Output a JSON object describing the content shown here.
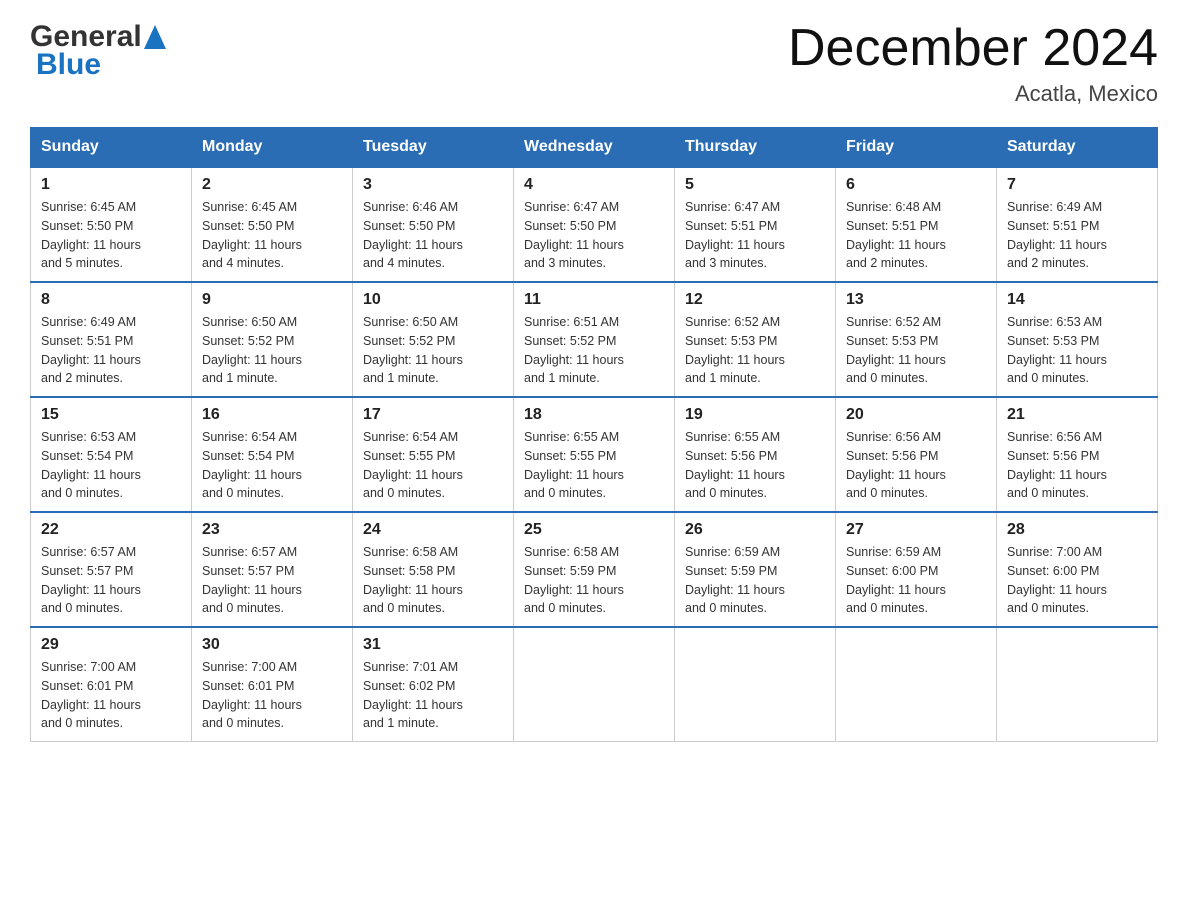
{
  "header": {
    "title": "December 2024",
    "location": "Acatla, Mexico",
    "logo_general": "General",
    "logo_blue": "Blue"
  },
  "weekdays": [
    "Sunday",
    "Monday",
    "Tuesday",
    "Wednesday",
    "Thursday",
    "Friday",
    "Saturday"
  ],
  "weeks": [
    [
      {
        "day": "1",
        "sunrise": "6:45 AM",
        "sunset": "5:50 PM",
        "daylight": "11 hours and 5 minutes."
      },
      {
        "day": "2",
        "sunrise": "6:45 AM",
        "sunset": "5:50 PM",
        "daylight": "11 hours and 4 minutes."
      },
      {
        "day": "3",
        "sunrise": "6:46 AM",
        "sunset": "5:50 PM",
        "daylight": "11 hours and 4 minutes."
      },
      {
        "day": "4",
        "sunrise": "6:47 AM",
        "sunset": "5:50 PM",
        "daylight": "11 hours and 3 minutes."
      },
      {
        "day": "5",
        "sunrise": "6:47 AM",
        "sunset": "5:51 PM",
        "daylight": "11 hours and 3 minutes."
      },
      {
        "day": "6",
        "sunrise": "6:48 AM",
        "sunset": "5:51 PM",
        "daylight": "11 hours and 2 minutes."
      },
      {
        "day": "7",
        "sunrise": "6:49 AM",
        "sunset": "5:51 PM",
        "daylight": "11 hours and 2 minutes."
      }
    ],
    [
      {
        "day": "8",
        "sunrise": "6:49 AM",
        "sunset": "5:51 PM",
        "daylight": "11 hours and 2 minutes."
      },
      {
        "day": "9",
        "sunrise": "6:50 AM",
        "sunset": "5:52 PM",
        "daylight": "11 hours and 1 minute."
      },
      {
        "day": "10",
        "sunrise": "6:50 AM",
        "sunset": "5:52 PM",
        "daylight": "11 hours and 1 minute."
      },
      {
        "day": "11",
        "sunrise": "6:51 AM",
        "sunset": "5:52 PM",
        "daylight": "11 hours and 1 minute."
      },
      {
        "day": "12",
        "sunrise": "6:52 AM",
        "sunset": "5:53 PM",
        "daylight": "11 hours and 1 minute."
      },
      {
        "day": "13",
        "sunrise": "6:52 AM",
        "sunset": "5:53 PM",
        "daylight": "11 hours and 0 minutes."
      },
      {
        "day": "14",
        "sunrise": "6:53 AM",
        "sunset": "5:53 PM",
        "daylight": "11 hours and 0 minutes."
      }
    ],
    [
      {
        "day": "15",
        "sunrise": "6:53 AM",
        "sunset": "5:54 PM",
        "daylight": "11 hours and 0 minutes."
      },
      {
        "day": "16",
        "sunrise": "6:54 AM",
        "sunset": "5:54 PM",
        "daylight": "11 hours and 0 minutes."
      },
      {
        "day": "17",
        "sunrise": "6:54 AM",
        "sunset": "5:55 PM",
        "daylight": "11 hours and 0 minutes."
      },
      {
        "day": "18",
        "sunrise": "6:55 AM",
        "sunset": "5:55 PM",
        "daylight": "11 hours and 0 minutes."
      },
      {
        "day": "19",
        "sunrise": "6:55 AM",
        "sunset": "5:56 PM",
        "daylight": "11 hours and 0 minutes."
      },
      {
        "day": "20",
        "sunrise": "6:56 AM",
        "sunset": "5:56 PM",
        "daylight": "11 hours and 0 minutes."
      },
      {
        "day": "21",
        "sunrise": "6:56 AM",
        "sunset": "5:56 PM",
        "daylight": "11 hours and 0 minutes."
      }
    ],
    [
      {
        "day": "22",
        "sunrise": "6:57 AM",
        "sunset": "5:57 PM",
        "daylight": "11 hours and 0 minutes."
      },
      {
        "day": "23",
        "sunrise": "6:57 AM",
        "sunset": "5:57 PM",
        "daylight": "11 hours and 0 minutes."
      },
      {
        "day": "24",
        "sunrise": "6:58 AM",
        "sunset": "5:58 PM",
        "daylight": "11 hours and 0 minutes."
      },
      {
        "day": "25",
        "sunrise": "6:58 AM",
        "sunset": "5:59 PM",
        "daylight": "11 hours and 0 minutes."
      },
      {
        "day": "26",
        "sunrise": "6:59 AM",
        "sunset": "5:59 PM",
        "daylight": "11 hours and 0 minutes."
      },
      {
        "day": "27",
        "sunrise": "6:59 AM",
        "sunset": "6:00 PM",
        "daylight": "11 hours and 0 minutes."
      },
      {
        "day": "28",
        "sunrise": "7:00 AM",
        "sunset": "6:00 PM",
        "daylight": "11 hours and 0 minutes."
      }
    ],
    [
      {
        "day": "29",
        "sunrise": "7:00 AM",
        "sunset": "6:01 PM",
        "daylight": "11 hours and 0 minutes."
      },
      {
        "day": "30",
        "sunrise": "7:00 AM",
        "sunset": "6:01 PM",
        "daylight": "11 hours and 0 minutes."
      },
      {
        "day": "31",
        "sunrise": "7:01 AM",
        "sunset": "6:02 PM",
        "daylight": "11 hours and 1 minute."
      },
      null,
      null,
      null,
      null
    ]
  ],
  "labels": {
    "sunrise": "Sunrise:",
    "sunset": "Sunset:",
    "daylight": "Daylight:"
  }
}
